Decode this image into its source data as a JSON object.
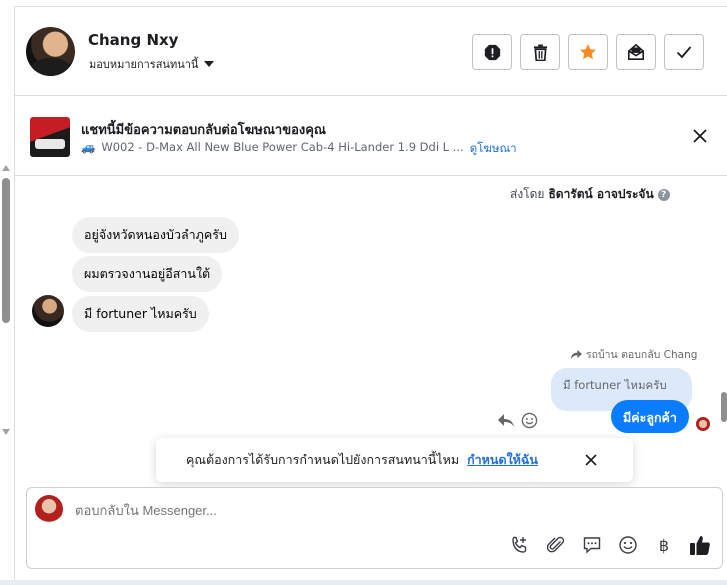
{
  "header": {
    "name": "Chang Nxy",
    "assign_label": "มอบหมายการสนทนานี้",
    "actions": [
      "alert-icon",
      "trash-icon",
      "star-icon",
      "mark-unread-icon",
      "check-icon"
    ],
    "star_color": "#f68b1f"
  },
  "ad": {
    "title": "แชทนี้มีข้อความตอบกลับต่อโฆษณาของคุณ",
    "car_glyph": "🚙",
    "subtitle": "W002 - D-Max All New Blue Power Cab-4 Hi-Lander 1.9 Ddi L ...",
    "link": "ดูโฆษณา"
  },
  "conversation": {
    "sent_by_prefix": "ส่งโดย",
    "sent_by_name": "ธิดารัตน์ อาจประจัน",
    "help": "?",
    "incoming": [
      "อยู่จังหวัดหนองบัวลำภูครับ",
      "ผมตรวจงานอยู่อีสานใต้",
      "มี fortuner ไหมครับ"
    ],
    "reply_meta": "รถบ้าน ตอบกลับ Chang",
    "quoted": "มี fortuner ไหมครับ",
    "outgoing": "มีค่ะลูกค้า"
  },
  "toast": {
    "text": "คุณต้องการได้รับการกำหนดไปยังการสนทนานี้ไหม",
    "link": "กำหนดให้ฉัน"
  },
  "composer": {
    "placeholder": "ตอบกลับใน Messenger...",
    "baht": "฿"
  },
  "colors": {
    "accent": "#0a7cff",
    "link": "#216fdb",
    "bubble_in": "#f0f0f0",
    "quoted": "#dce9fb"
  }
}
